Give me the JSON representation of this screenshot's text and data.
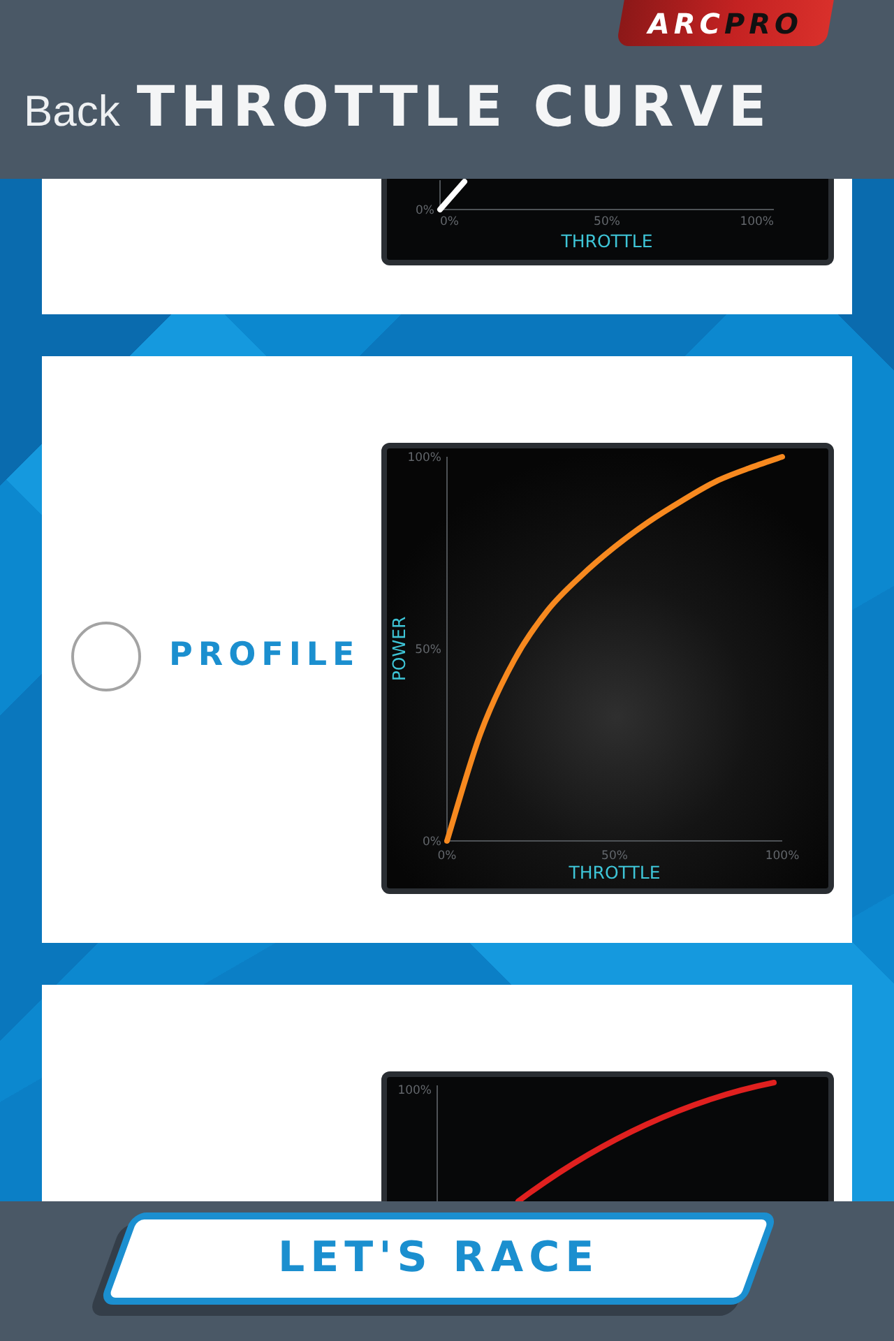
{
  "header": {
    "logo": {
      "text_1": "ARC",
      "text_2": "PRO"
    },
    "back": "Back",
    "title": "THROTTLE CURVE"
  },
  "profiles": [
    {
      "kind": "lower_part",
      "color": "#ffffff",
      "chart": {
        "y_ticks": [
          "0%"
        ],
        "x_ticks": [
          "0%",
          "50%",
          "100%"
        ],
        "x_title": "THROTTLE"
      }
    },
    {
      "kind": "whole",
      "selected": false,
      "label": "PROFILE",
      "chart_data": {
        "type": "line",
        "xlabel": "THROTTLE",
        "ylabel": "POWER",
        "x": [
          0,
          10,
          20,
          30,
          40,
          50,
          60,
          70,
          80,
          90,
          100
        ],
        "series": [
          {
            "color": "#f7891f",
            "values": [
              0,
              28,
              47,
              60,
              69,
              76.5,
              83,
              88.5,
              93.5,
              97,
              100
            ]
          }
        ],
        "xlim": [
          0,
          100
        ],
        "ylim": [
          0,
          100
        ],
        "xticks": [
          {
            "value": 0,
            "label": "0%"
          },
          {
            "value": 50,
            "label": "50%"
          },
          {
            "value": 100,
            "label": "100%"
          }
        ],
        "yticks": [
          {
            "value": 0,
            "label": "0%"
          },
          {
            "value": 50,
            "label": "50%"
          },
          {
            "value": 100,
            "label": "100%"
          }
        ]
      }
    },
    {
      "kind": "upper_part",
      "color": "#e0201f",
      "chart": {
        "y_ticks": [
          "100%"
        ]
      }
    }
  ],
  "footer": {
    "button": "LET'S RACE"
  }
}
